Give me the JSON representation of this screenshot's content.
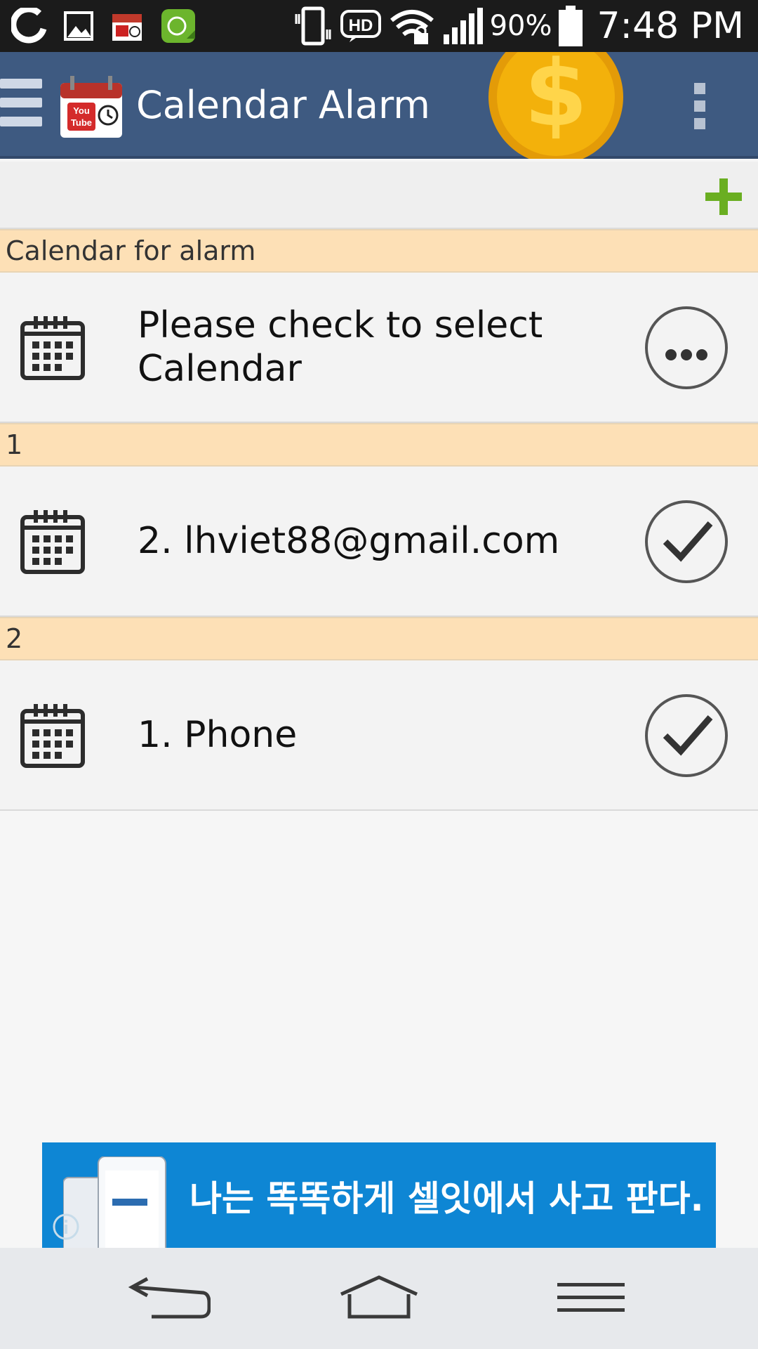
{
  "status_bar": {
    "notification_icons": [
      "carrier-icon",
      "gallery-icon",
      "calendar-alarm-icon",
      "sms-app-icon"
    ],
    "system_icons": [
      "vibrate-icon",
      "hd-icon",
      "wifi-lock-icon",
      "signal-icon"
    ],
    "battery_percent": "90%",
    "time": "7:48 PM"
  },
  "action_bar": {
    "title": "Calendar Alarm",
    "icons": [
      "menu-icon",
      "app-logo-icon",
      "coin-dollar-icon",
      "overflow-menu-icon"
    ],
    "colors": {
      "background": "#3e5a81",
      "coin": "#f3b10b"
    }
  },
  "toolbar": {
    "add_icon": "plus-icon",
    "add_color": "#6aae21"
  },
  "calendars": {
    "sections": [
      {
        "header": "Calendar for alarm",
        "row": {
          "label": "Please check to select Calendar",
          "action_icon": "more-circle-icon"
        }
      },
      {
        "header": "1",
        "row": {
          "label": "2. lhviet88@gmail.com",
          "action_icon": "check-circle-icon"
        }
      },
      {
        "header": "2",
        "row": {
          "label": "1. Phone",
          "action_icon": "check-circle-icon"
        }
      }
    ],
    "colors": {
      "section_header": "#fde0b6"
    }
  },
  "ad": {
    "text": "나는 똑똑하게 셀잇에서 사고 판다.",
    "icons": [
      "phone-mockup-icon",
      "info-icon"
    ],
    "background": "#0e86d4"
  },
  "nav_bar": {
    "buttons": [
      "back-icon",
      "home-icon",
      "recent-apps-icon"
    ]
  }
}
